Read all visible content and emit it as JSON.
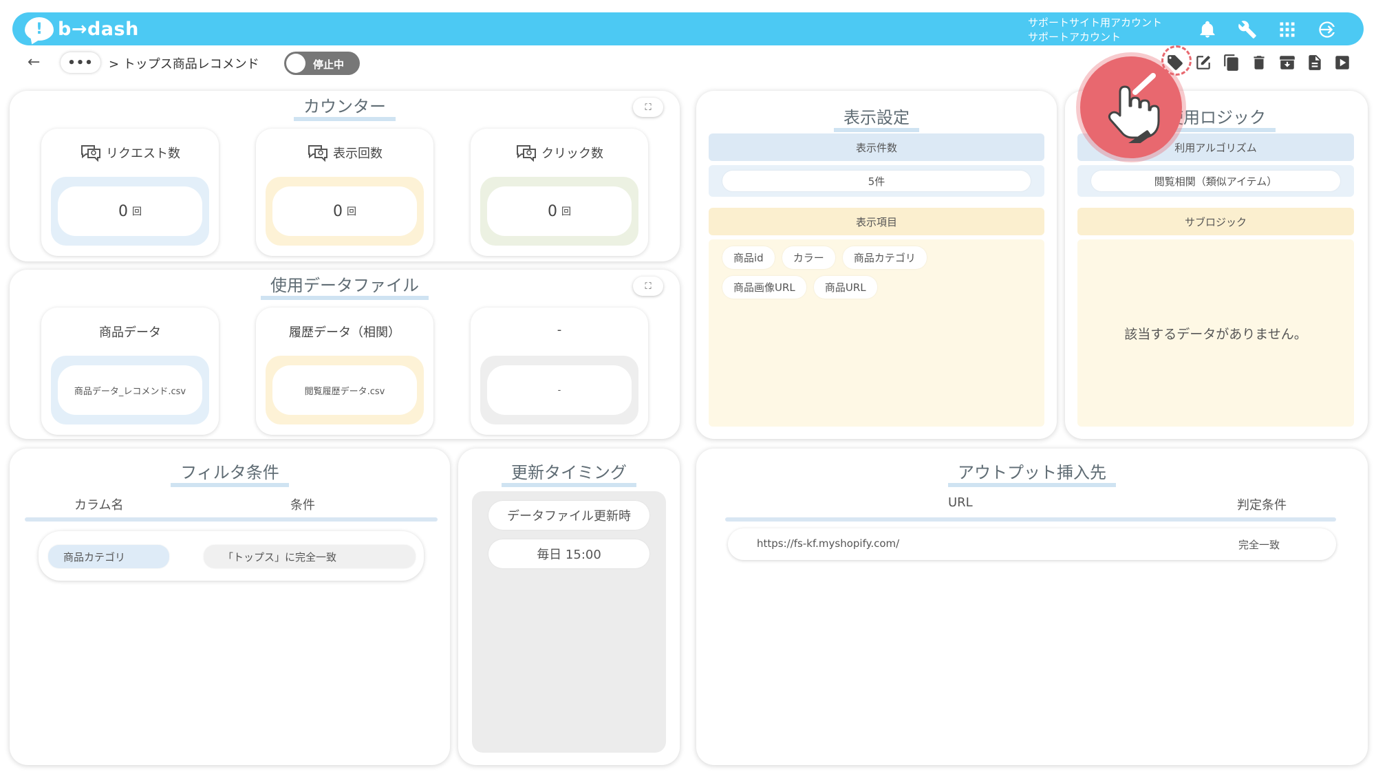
{
  "header": {
    "logo_symbol": "!",
    "logo_text": "b→dash",
    "account_line1": "サポートサイト用アカウント",
    "account_line2": "サポートアカウント",
    "icons": [
      "bell-icon",
      "wrench-icon",
      "apps-grid-icon",
      "logout-icon"
    ],
    "color": "#4cc9f3"
  },
  "toolbar": {
    "back_glyph": "←",
    "more_label": "•••",
    "breadcrumb": "> トップス商品レコメンド",
    "status_label": "停止中",
    "icons": [
      "tag-icon",
      "edit-icon",
      "copy-icon",
      "trash-icon",
      "archive-icon",
      "document-icon",
      "play-icon"
    ]
  },
  "counter": {
    "title": "カウンター",
    "stats": [
      {
        "label": "リクエスト数",
        "value": "0",
        "unit": "回"
      },
      {
        "label": "表示回数",
        "value": "0",
        "unit": "回"
      },
      {
        "label": "クリック数",
        "value": "0",
        "unit": "回"
      }
    ]
  },
  "data_files": {
    "title": "使用データファイル",
    "files": [
      {
        "label": "商品データ",
        "file": "商品データ_レコメンド.csv"
      },
      {
        "label": "履歴データ（相関）",
        "file": "閲覧履歴データ.csv"
      },
      {
        "label": "-",
        "file": "-"
      }
    ]
  },
  "display_settings": {
    "title": "表示設定",
    "count_header": "表示件数",
    "count_value": "5件",
    "items_header": "表示項目",
    "items": [
      "商品id",
      "カラー",
      "商品カテゴリ",
      "商品画像URL",
      "商品URL"
    ]
  },
  "logic": {
    "title": "使用ロジック",
    "algorithm_header": "利用アルゴリズム",
    "algorithm_value": "閲覧相関（類似アイテム）",
    "sub_header": "サブロジック",
    "empty_message": "該当するデータがありません。"
  },
  "filter": {
    "title": "フィルタ条件",
    "col_name": "カラム名",
    "col_condition": "条件",
    "rows": [
      {
        "column": "商品カテゴリ",
        "condition": "「トップス」に完全一致"
      }
    ]
  },
  "update_timing": {
    "title": "更新タイミング",
    "trigger": "データファイル更新時",
    "schedule": "毎日 15:00"
  },
  "output": {
    "title": "アウトプット挿入先",
    "col_url": "URL",
    "col_condition": "判定条件",
    "rows": [
      {
        "url": "https://fs-kf.myshopify.com/",
        "condition": "完全一致"
      }
    ]
  }
}
